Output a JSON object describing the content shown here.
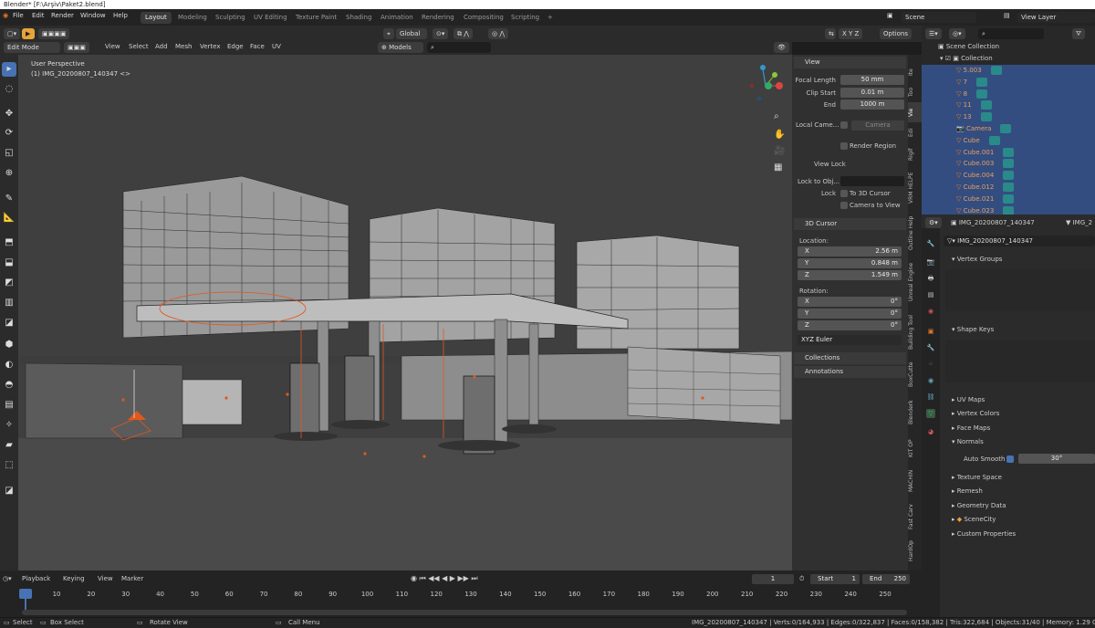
{
  "window": {
    "title": "Blender* [F:\\Arşiv\\Paket2.blend]"
  },
  "menu": [
    "File",
    "Edit",
    "Render",
    "Window",
    "Help"
  ],
  "workspaces": [
    "Layout",
    "Modeling",
    "Sculpting",
    "UV Editing",
    "Texture Paint",
    "Shading",
    "Animation",
    "Rendering",
    "Compositing",
    "Scripting",
    "+"
  ],
  "topright": {
    "scene": "Scene",
    "view_layer": "View Layer"
  },
  "viewport_header": {
    "mode": "Edit Mode",
    "menus": [
      "View",
      "Select",
      "Add",
      "Mesh",
      "Vertex",
      "Edge",
      "Face",
      "UV"
    ],
    "orientation": "Global",
    "pivot": "Models",
    "options": "Options",
    "axes": [
      "X",
      "Y",
      "Z"
    ]
  },
  "viewport": {
    "view_name": "User Perspective",
    "object_label": "(1) IMG_20200807_140347 <>"
  },
  "npanel": {
    "view": {
      "title": "View",
      "focal_label": "Focal Length",
      "focal": "50 mm",
      "clip_start_label": "Clip Start",
      "clip_start": "0.01 m",
      "end_label": "End",
      "end": "1000 m",
      "local_camera_label": "Local Came...",
      "camera": "Camera",
      "render_region": "Render Region",
      "view_lock": "View Lock",
      "lock_obj_label": "Lock to Obj...",
      "lock_label": "Lock",
      "to_3d_cursor": "To 3D Cursor",
      "camera_to_view": "Camera to View"
    },
    "cursor": {
      "title": "3D Cursor",
      "location_label": "Location:",
      "x_label": "X",
      "x": "2.56 m",
      "y_label": "Y",
      "y": "0.848 m",
      "z_label": "Z",
      "z": "1.549 m",
      "rotation_label": "Rotation:",
      "rx": "0°",
      "ry": "0°",
      "rz": "0°",
      "mode": "XYZ Euler"
    },
    "collections": "Collections",
    "annotations": "Annotations",
    "tabs": [
      "Ite",
      "Too",
      "Vie",
      "Edi",
      "Rigif",
      "VRM HELPE",
      "Outline Help",
      "Unreal Engine",
      "Building Tool",
      "BoxCutte",
      "Blenderk",
      "KIT OP",
      "MACHIN",
      "Fast Carv",
      "HardOp"
    ]
  },
  "outliner": {
    "search_placeholder": "",
    "scene_collection": "Scene Collection",
    "collection": "Collection",
    "items": [
      "5.003",
      "7",
      "8",
      "11",
      "13",
      "Camera",
      "Cube",
      "Cube.001",
      "Cube.003",
      "Cube.004",
      "Cube.012",
      "Cube.021",
      "Cube.023"
    ]
  },
  "properties": {
    "object": "IMG_20200807_140347",
    "object_short": "IMG_2",
    "mesh": "IMG_20200807_140347",
    "sections": [
      "Vertex Groups",
      "Shape Keys",
      "UV Maps",
      "Vertex Colors",
      "Face Maps",
      "Normals",
      "Texture Space",
      "Remesh",
      "Geometry Data",
      "SceneCity",
      "Custom Properties"
    ],
    "auto_smooth_label": "Auto Smooth",
    "auto_smooth": "30°"
  },
  "timeline": {
    "menus": [
      "Playback",
      "Keying",
      "View",
      "Marker"
    ],
    "current_frame": "1",
    "start_label": "Start",
    "start": "1",
    "end_label": "End",
    "end": "250",
    "ticks": [
      "1",
      "10",
      "20",
      "30",
      "40",
      "50",
      "60",
      "70",
      "80",
      "90",
      "100",
      "110",
      "120",
      "130",
      "140",
      "150",
      "160",
      "170",
      "180",
      "190",
      "200",
      "210",
      "220",
      "230",
      "240",
      "250"
    ]
  },
  "status": {
    "select": "Select",
    "box_select": "Box Select",
    "rotate": "Rotate View",
    "call_menu": "Call Menu",
    "stats": "IMG_20200807_140347 | Verts:0/164,933 | Edges:0/322,837 | Faces:0/158,382 | Tris:322,684 | Objects:31/40 | Memory: 1.29 GiB | 2.9"
  }
}
